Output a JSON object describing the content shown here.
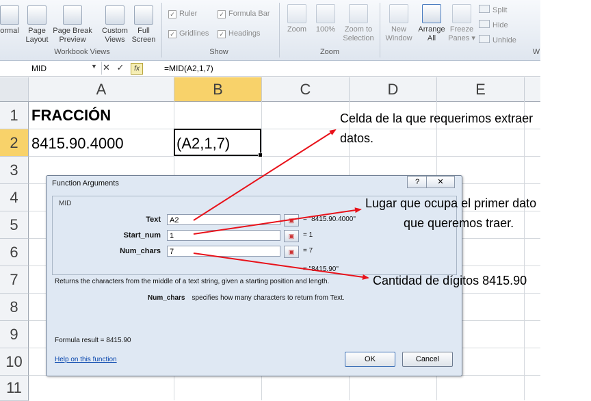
{
  "ribbon": {
    "workbook_views": {
      "normal": "ormal",
      "page_layout": "Page\nLayout",
      "page_break": "Page Break\nPreview",
      "custom_views": "Custom\nViews",
      "full_screen": "Full\nScreen",
      "group": "Workbook Views"
    },
    "show": {
      "ruler": "Ruler",
      "formula_bar": "Formula Bar",
      "gridlines": "Gridlines",
      "headings": "Headings",
      "group": "Show"
    },
    "zoom": {
      "zoom": "Zoom",
      "hundred": "100%",
      "selection": "Zoom to\nSelection",
      "group": "Zoom"
    },
    "window": {
      "new_window": "New\nWindow",
      "arrange_all": "Arrange\nAll",
      "freeze": "Freeze\nPanes ▾",
      "split": "Split",
      "hide": "Hide",
      "unhide": "Unhide",
      "group_fragment": "W"
    }
  },
  "formula_bar": {
    "name_box": "MID",
    "formula": "=MID(A2,1,7)",
    "cancel": "✕",
    "enter": "✓",
    "fx": "fx"
  },
  "columns": [
    "A",
    "B",
    "C",
    "D",
    "E"
  ],
  "rows": [
    "1",
    "2",
    "3",
    "4",
    "5",
    "6",
    "7",
    "8",
    "9",
    "10",
    "11"
  ],
  "cells": {
    "A1": "FRACCIÓN",
    "A2": "8415.90.4000",
    "B2": "(A2,1,7)"
  },
  "dialog": {
    "title": "Function Arguments",
    "help": "?",
    "close": "✕",
    "function_name": "MID",
    "args": [
      {
        "label": "Text",
        "value": "A2",
        "result": "=  \"8415.90.4000\""
      },
      {
        "label": "Start_num",
        "value": "1",
        "result": "=  1"
      },
      {
        "label": "Num_chars",
        "value": "7",
        "result": "=  7"
      }
    ],
    "overall_result": "=  \"8415.90\"",
    "description": "Returns the characters from the middle of a text string, given a starting position and length.",
    "arg_desc_name": "Num_chars",
    "arg_desc_text": "specifies how many characters to return from Text.",
    "formula_result": "Formula result =    8415.90",
    "help_link": "Help on this function",
    "ok": "OK",
    "cancel": "Cancel"
  },
  "annotations": {
    "cell_note_line1": "Celda de la que requerimos extraer",
    "cell_note_line2": "datos.",
    "start_note_line1": "Lugar que ocupa el primer dato",
    "start_note_line2": "que queremos traer.",
    "chars_note": "Cantidad de dígitos 8415.90"
  },
  "colors": {
    "accent_selected_header": "#f8d26a",
    "arrow": "#e8121a",
    "link": "#0645ad"
  }
}
